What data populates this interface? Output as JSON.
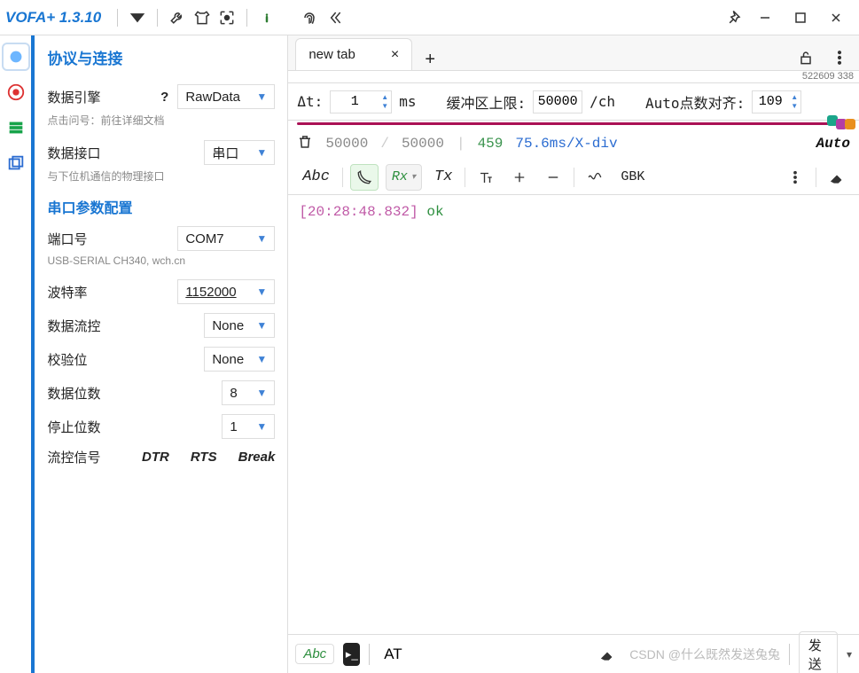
{
  "app": {
    "title": "VOFA+ 1.3.10"
  },
  "sidebar": {
    "heading_protocol": "协议与连接",
    "engine_label": "数据引擎",
    "engine_value": "RawData",
    "engine_help": "点击问号：前往详细文档",
    "iface_label": "数据接口",
    "iface_value": "串口",
    "iface_help": "与下位机通信的物理接口",
    "heading_serial": "串口参数配置",
    "port_label": "端口号",
    "port_value": "COM7",
    "port_help": "USB-SERIAL CH340, wch.cn",
    "baud_label": "波特率",
    "baud_value": "1152000",
    "flow_label": "数据流控",
    "flow_value": "None",
    "parity_label": "校验位",
    "parity_value": "None",
    "databits_label": "数据位数",
    "databits_value": "8",
    "stopbits_label": "停止位数",
    "stopbits_value": "1",
    "flowsig_label": "流控信号",
    "flowsig": {
      "dtr": "DTR",
      "rts": "RTS",
      "break": "Break"
    }
  },
  "tabs": {
    "active": "new tab"
  },
  "ruler": {
    "coord": "522609 338"
  },
  "params": {
    "dt_label": "Δt:",
    "dt_value": "1",
    "dt_unit": "ms",
    "buf_label": "缓冲区上限:",
    "buf_value": "50000",
    "buf_unit": "/ch",
    "align_label": "Auto点数对齐:",
    "align_value": "109"
  },
  "stats": {
    "a": "50000",
    "b": "50000",
    "count": "459",
    "rate": "75.6ms/X-div",
    "auto": "Auto"
  },
  "ctrl": {
    "abc": "Abc",
    "rx": "Rx",
    "tx": "Tx",
    "encoding": "GBK"
  },
  "console": {
    "ts": "[20:28:48.832]",
    "msg": "ok"
  },
  "bottom": {
    "abc": "Abc",
    "cmd": "AT",
    "watermark": "CSDN @什么既然发送兔兔",
    "send": "发送"
  },
  "colors": {
    "dot1": "#1aa58a",
    "dot2": "#b33da6",
    "dot3": "#e98f1e"
  }
}
